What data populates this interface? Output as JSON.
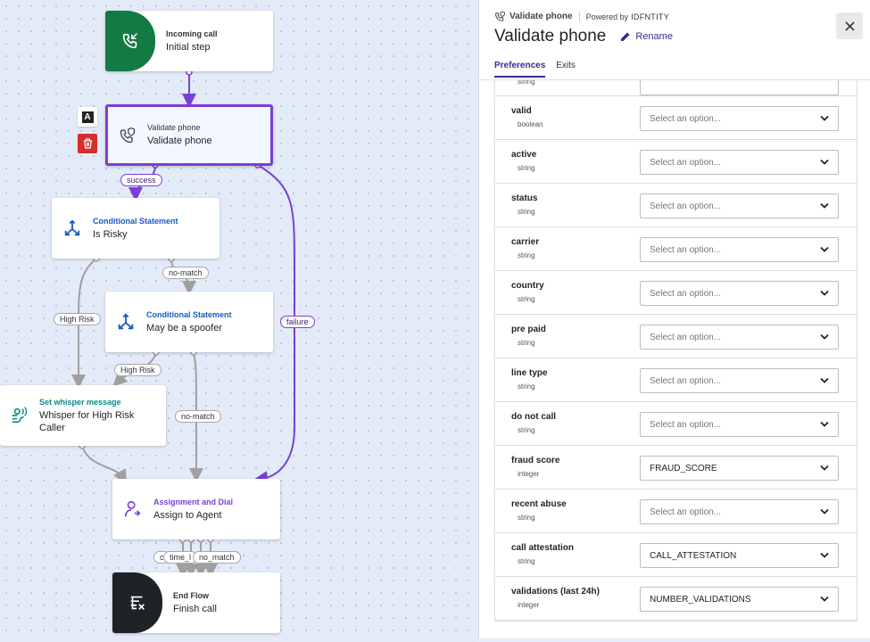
{
  "nodes": {
    "incoming": {
      "kind": "Incoming call",
      "name": "Initial step",
      "color": "#127a43"
    },
    "validate": {
      "kind": "Validate phone",
      "name": "Validate phone"
    },
    "risky": {
      "kind": "Conditional Statement",
      "name": "Is Risky"
    },
    "spoofer": {
      "kind": "Conditional Statement",
      "name": "May be a spoofer"
    },
    "whisper": {
      "kind": "Set whisper message",
      "name": "Whisper for High Risk Caller"
    },
    "assign": {
      "kind": "Assignment and Dial",
      "name": "Assign to Agent"
    },
    "end": {
      "kind": "End Flow",
      "name": "Finish call",
      "color": "#1e2328"
    }
  },
  "edge_labels": {
    "success": "success",
    "no_match_1": "no-match",
    "high_risk_1": "High Risk",
    "failure": "failure",
    "high_risk_2": "High Risk",
    "no_match_2": "no-match",
    "bottom_c": "c",
    "time_l": "time_l",
    "no_match_3": "no_match"
  },
  "side_buttons": {
    "letter": "A"
  },
  "panel": {
    "header_small": "Validate phone",
    "powered_by": "Powered by",
    "brand": "IDFNTITY",
    "title": "Validate phone",
    "rename": "Rename",
    "tabs": [
      "Preferences",
      "Exits"
    ],
    "first_type": "string",
    "properties": [
      {
        "name": "valid",
        "type": "boolean",
        "value": "Select an option...",
        "placeholder": true
      },
      {
        "name": "active",
        "type": "string",
        "value": "Select an option...",
        "placeholder": true
      },
      {
        "name": "status",
        "type": "string",
        "value": "Select an option...",
        "placeholder": true
      },
      {
        "name": "carrier",
        "type": "string",
        "value": "Select an option...",
        "placeholder": true
      },
      {
        "name": "country",
        "type": "string",
        "value": "Select an option...",
        "placeholder": true
      },
      {
        "name": "pre paid",
        "type": "string",
        "value": "Select an option...",
        "placeholder": true
      },
      {
        "name": "line type",
        "type": "string",
        "value": "Select an option...",
        "placeholder": true
      },
      {
        "name": "do not call",
        "type": "string",
        "value": "Select an option...",
        "placeholder": true
      },
      {
        "name": "fraud score",
        "type": "integer",
        "value": "FRAUD_SCORE",
        "placeholder": false
      },
      {
        "name": "recent abuse",
        "type": "string",
        "value": "Select an option...",
        "placeholder": true
      },
      {
        "name": "call attestation",
        "type": "string",
        "value": "CALL_ATTESTATION",
        "placeholder": false
      },
      {
        "name": "validations (last 24h)",
        "type": "integer",
        "value": "NUMBER_VALIDATIONS",
        "placeholder": false
      }
    ]
  },
  "colors": {
    "accent": "#7b3fd6",
    "delete": "#d32f2f",
    "blue": "#1a5bc4",
    "teal": "#0d8a8a"
  }
}
